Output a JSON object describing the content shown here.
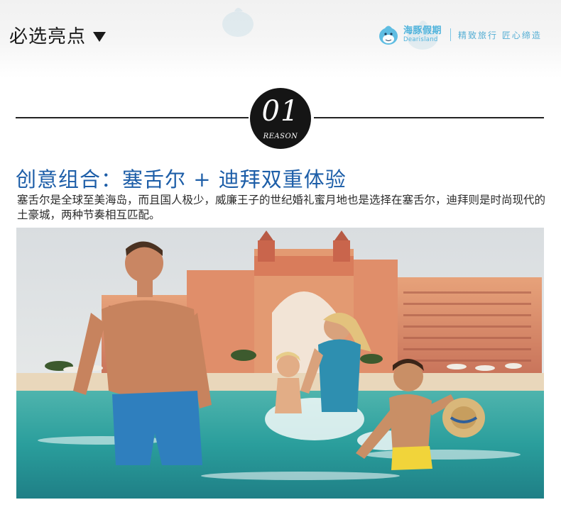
{
  "header": {
    "section_title": "必选亮点",
    "brand": {
      "name_cn": "海豚假期",
      "name_en": "Dearisland",
      "slogan": "精致旅行 匠心缔造"
    }
  },
  "badge": {
    "number": "01",
    "word": "REASON"
  },
  "content": {
    "headline": "创意组合：塞舌尔 + 迪拜双重体验",
    "description": "塞舌尔是全球至美海岛，而且国人极少，威廉王子的世纪婚礼蜜月地也是选择在塞舌尔，迪拜则是时尚现代的土豪城，两种节奏相互匹配。"
  },
  "colors": {
    "headline": "#1d5ea8",
    "brand": "#4fb3dc",
    "badge": "#151515"
  }
}
